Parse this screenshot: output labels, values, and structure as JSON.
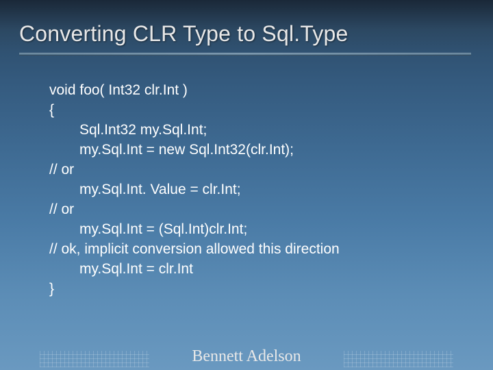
{
  "title": "Converting CLR Type to Sql.Type",
  "code": {
    "l1": "void foo( Int32 clr.Int )",
    "l2": "{",
    "l3": "Sql.Int32 my.Sql.Int;",
    "l4": "my.Sql.Int = new Sql.Int32(clr.Int);",
    "l5": "// or",
    "l6": "my.Sql.Int. Value = clr.Int;",
    "l7": "// or",
    "l8": "my.Sql.Int = (Sql.Int)clr.Int;",
    "l9": "// ok, implicit conversion allowed this direction",
    "l10": "my.Sql.Int = clr.Int",
    "l11": "}"
  },
  "footer": "Bennett Adelson"
}
